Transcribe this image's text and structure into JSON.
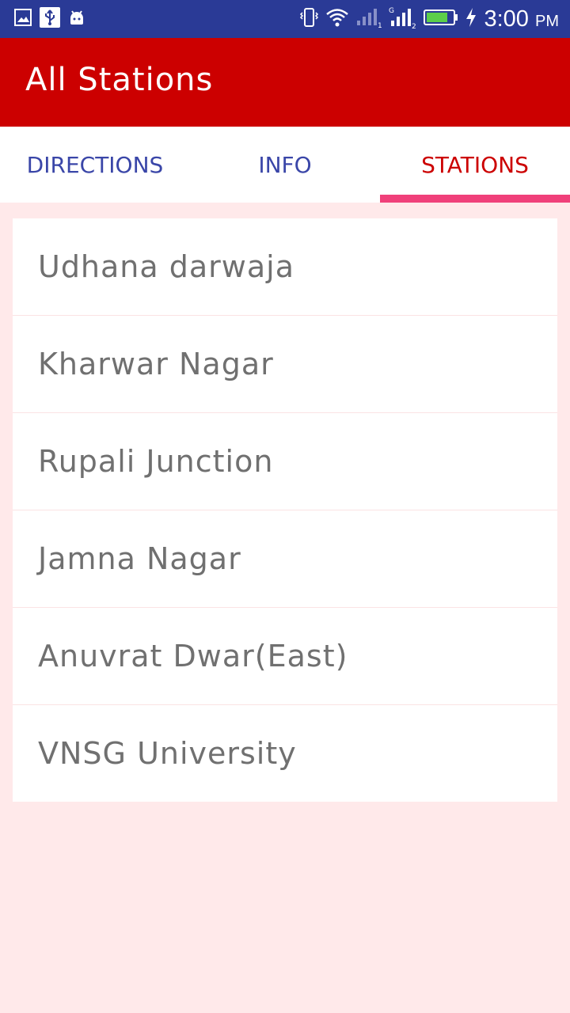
{
  "colors": {
    "status_bar": "#2a3a96",
    "app_bar": "#cc0000",
    "tab_active": "#cc0000",
    "tab_inactive": "#3a46a8",
    "indicator": "#f0407a",
    "background": "#ffe9ea",
    "item_text": "#707070"
  },
  "status_bar": {
    "time": "3:00",
    "ampm": "PM",
    "icons_left": [
      "image-icon",
      "usb-icon",
      "android-icon"
    ],
    "icons_right": [
      "vibrate-icon",
      "wifi-icon",
      "signal-sim1-icon",
      "signal-sim2-icon",
      "battery-icon",
      "charging-icon"
    ]
  },
  "app_bar": {
    "title": "All Stations"
  },
  "tabs": [
    {
      "label": "DIRECTIONS",
      "active": false
    },
    {
      "label": "INFO",
      "active": false
    },
    {
      "label": "STATIONS",
      "active": true
    }
  ],
  "stations": [
    {
      "label": "Udhana darwaja"
    },
    {
      "label": "Kharwar Nagar"
    },
    {
      "label": "Rupali Junction"
    },
    {
      "label": "Jamna Nagar"
    },
    {
      "label": "Anuvrat Dwar(East)"
    },
    {
      "label": "VNSG University"
    }
  ]
}
